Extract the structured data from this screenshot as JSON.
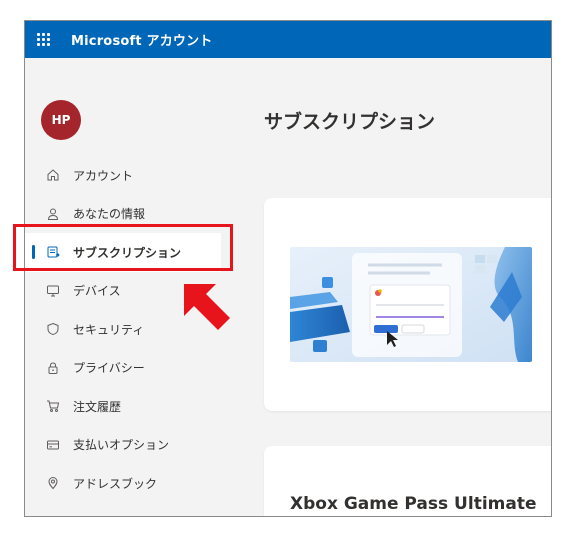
{
  "header": {
    "brand": "Microsoft アカウント"
  },
  "user": {
    "initials": "HP"
  },
  "nav": {
    "items": [
      {
        "label": "アカウント",
        "icon": "home-icon"
      },
      {
        "label": "あなたの情報",
        "icon": "person-icon"
      },
      {
        "label": "サブスクリプション",
        "icon": "subscription-icon",
        "active": true
      },
      {
        "label": "デバイス",
        "icon": "monitor-icon"
      },
      {
        "label": "セキュリティ",
        "icon": "shield-icon"
      },
      {
        "label": "プライバシー",
        "icon": "lock-icon"
      },
      {
        "label": "注文履歴",
        "icon": "cart-icon"
      },
      {
        "label": "支払いオプション",
        "icon": "card-icon"
      },
      {
        "label": "アドレスブック",
        "icon": "location-icon"
      }
    ]
  },
  "main": {
    "title": "サブスクリプション",
    "card2_title": "Xbox Game Pass Ultimate"
  },
  "colors": {
    "header_bg": "#0067b8",
    "avatar_bg": "#a4262c",
    "highlight": "#e8141b",
    "active_indicator": "#0067b8"
  }
}
